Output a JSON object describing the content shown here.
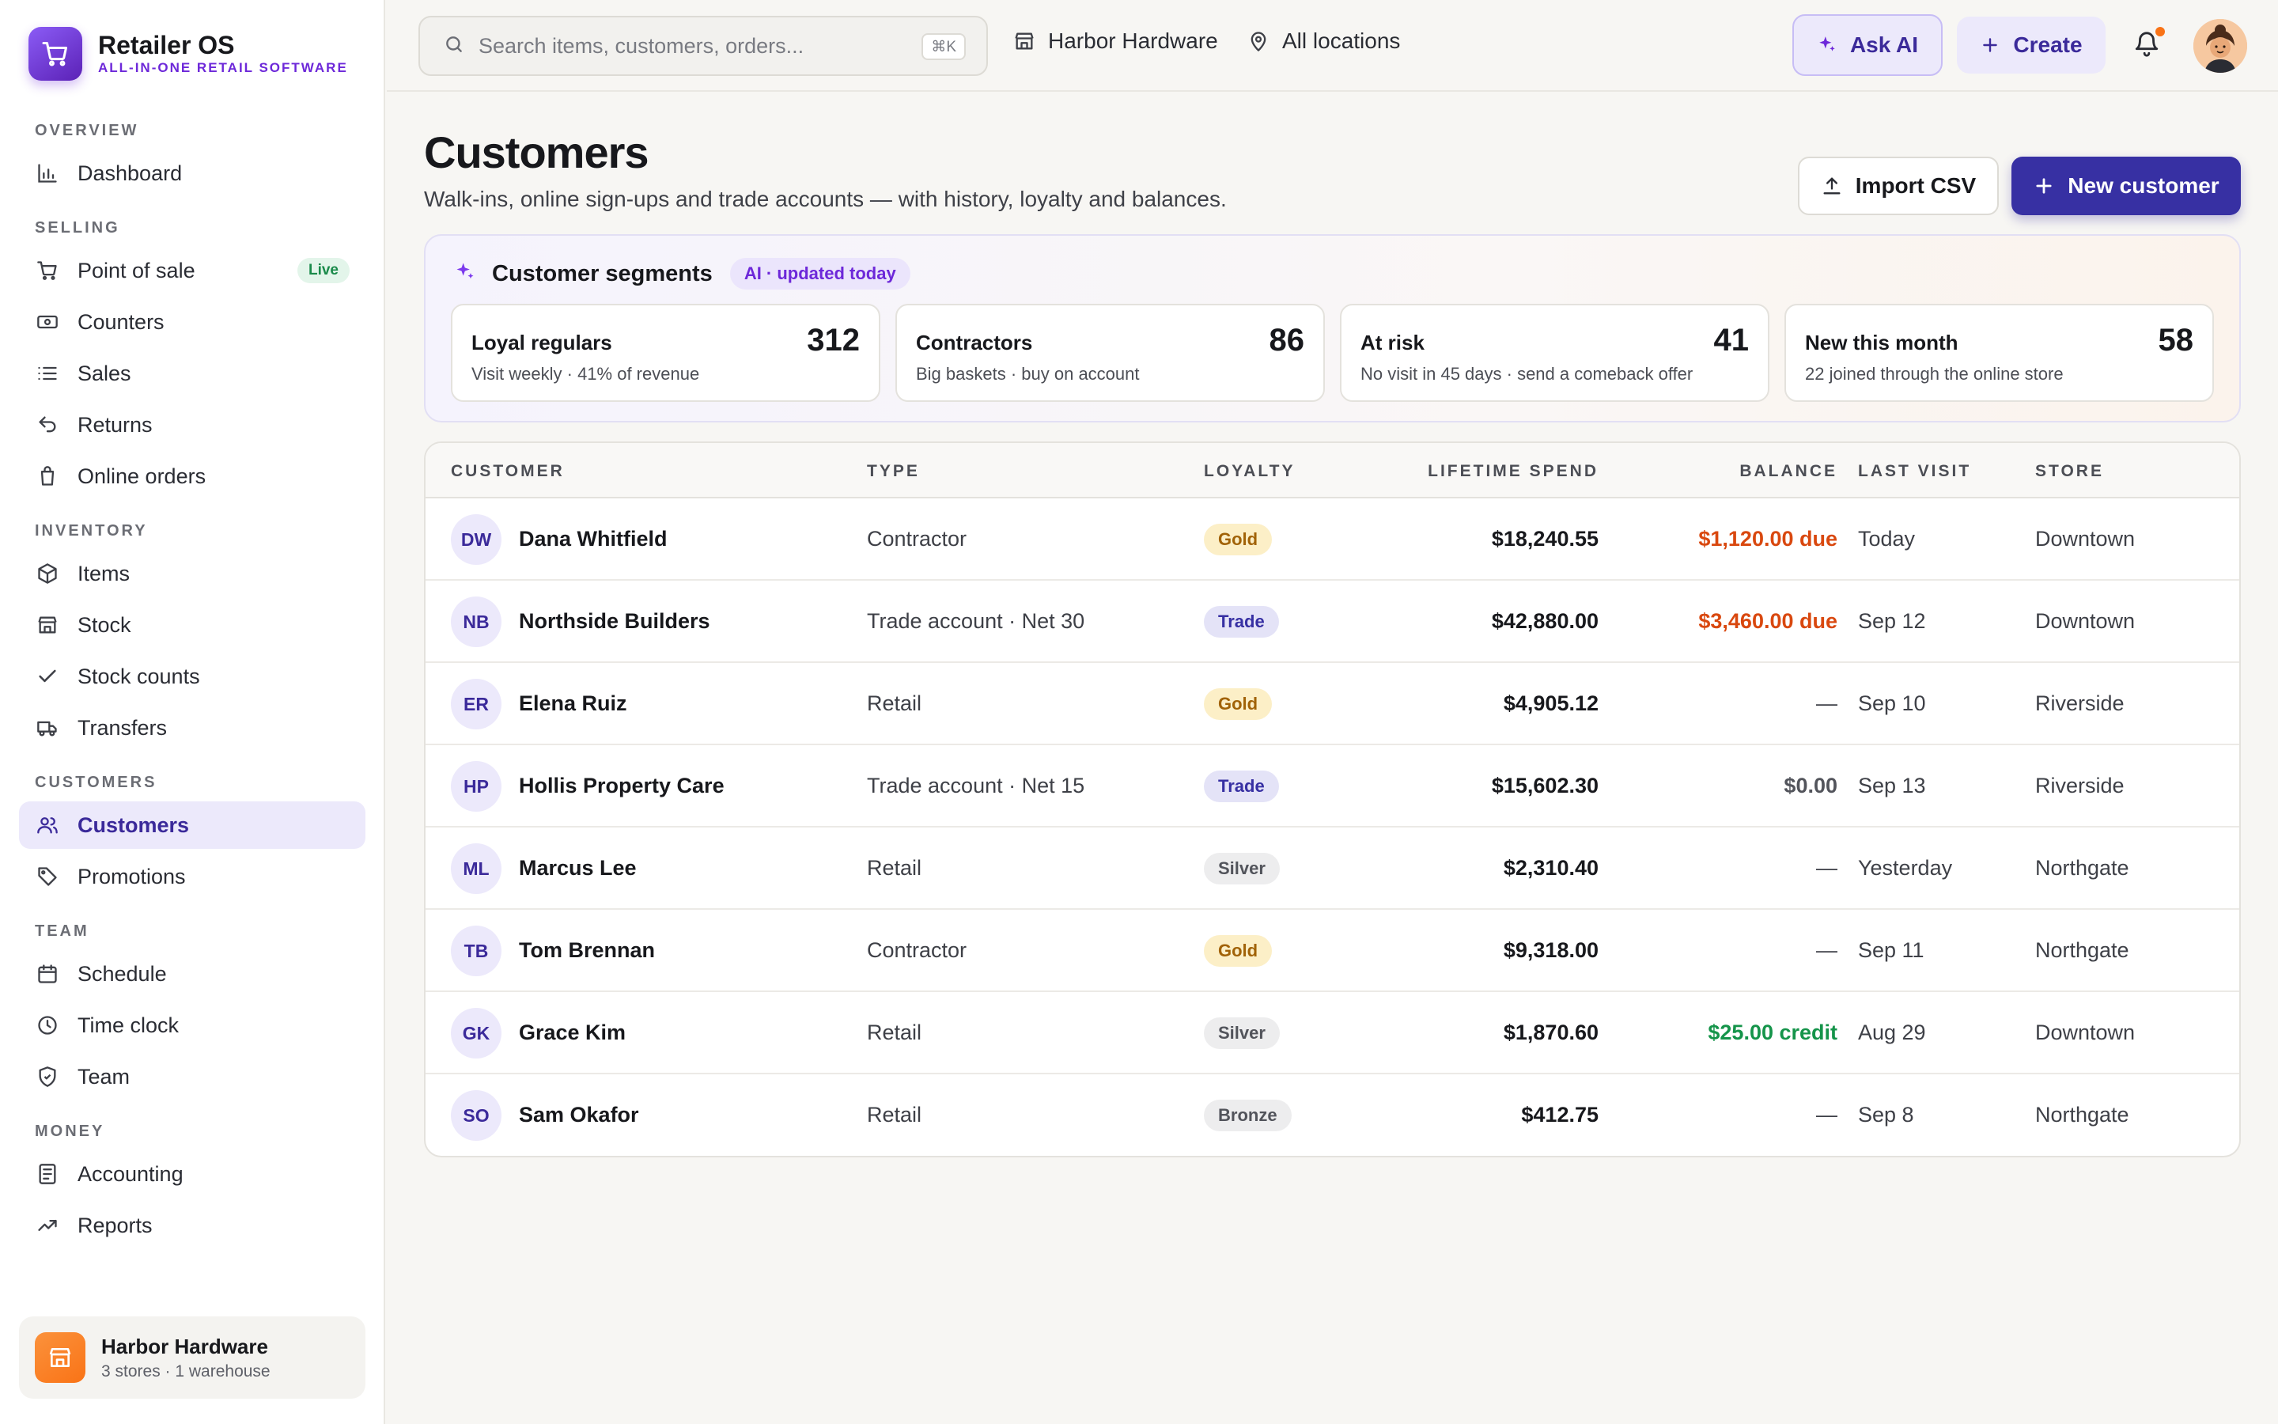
{
  "brand": {
    "name": "Retailer OS",
    "tagline": "ALL-IN-ONE RETAIL SOFTWARE"
  },
  "sidebar": {
    "sections": [
      {
        "label": "OVERVIEW",
        "items": [
          {
            "label": "Dashboard",
            "icon": "bar-chart-icon"
          }
        ]
      },
      {
        "label": "SELLING",
        "items": [
          {
            "label": "Point of sale",
            "icon": "cart-icon",
            "badge": "Live"
          },
          {
            "label": "Counters",
            "icon": "register-icon"
          },
          {
            "label": "Sales",
            "icon": "list-icon"
          },
          {
            "label": "Returns",
            "icon": "return-icon"
          },
          {
            "label": "Online orders",
            "icon": "bag-icon"
          }
        ]
      },
      {
        "label": "INVENTORY",
        "items": [
          {
            "label": "Items",
            "icon": "box-icon"
          },
          {
            "label": "Stock",
            "icon": "store-icon"
          },
          {
            "label": "Stock counts",
            "icon": "check-icon"
          },
          {
            "label": "Transfers",
            "icon": "truck-icon"
          }
        ]
      },
      {
        "label": "CUSTOMERS",
        "items": [
          {
            "label": "Customers",
            "icon": "users-icon",
            "active": true
          },
          {
            "label": "Promotions",
            "icon": "tag-icon"
          }
        ]
      },
      {
        "label": "TEAM",
        "items": [
          {
            "label": "Schedule",
            "icon": "calendar-icon"
          },
          {
            "label": "Time clock",
            "icon": "clock-icon"
          },
          {
            "label": "Team",
            "icon": "shield-icon"
          }
        ]
      },
      {
        "label": "MONEY",
        "items": [
          {
            "label": "Accounting",
            "icon": "ledger-icon"
          },
          {
            "label": "Reports",
            "icon": "trend-icon"
          }
        ]
      }
    ],
    "store": {
      "name": "Harbor Hardware",
      "sub": "3 stores · 1 warehouse"
    }
  },
  "topbar": {
    "search_placeholder": "Search items, customers, orders...",
    "shortcut": "⌘K",
    "business": "Harbor Hardware",
    "location": "All locations",
    "ask_ai": "Ask AI",
    "create": "Create"
  },
  "page": {
    "title": "Customers",
    "subtitle": "Walk-ins, online sign-ups and trade accounts — with history, loyalty and balances.",
    "import_label": "Import CSV",
    "new_label": "New customer"
  },
  "segments": {
    "title": "Customer segments",
    "ai_badge": "AI · updated today",
    "cards": [
      {
        "name": "Loyal regulars",
        "desc": "Visit weekly · 41% of revenue",
        "count": "312"
      },
      {
        "name": "Contractors",
        "desc": "Big baskets · buy on account",
        "count": "86"
      },
      {
        "name": "At risk",
        "desc": "No visit in 45 days · send a comeback offer",
        "count": "41"
      },
      {
        "name": "New this month",
        "desc": "22 joined through the online store",
        "count": "58"
      }
    ]
  },
  "table": {
    "headers": {
      "customer": "CUSTOMER",
      "type": "TYPE",
      "loyalty": "LOYALTY",
      "spend": "LIFETIME SPEND",
      "balance": "BALANCE",
      "last_visit": "LAST VISIT",
      "store": "STORE"
    },
    "rows": [
      {
        "initials": "DW",
        "name": "Dana Whitfield",
        "type": "Contractor",
        "loyalty": "Gold",
        "spend": "$18,240.55",
        "balance": "$1,120.00 due",
        "balance_kind": "due",
        "last_visit": "Today",
        "store": "Downtown"
      },
      {
        "initials": "NB",
        "name": "Northside Builders",
        "type": "Trade account · Net 30",
        "loyalty": "Trade",
        "spend": "$42,880.00",
        "balance": "$3,460.00 due",
        "balance_kind": "due",
        "last_visit": "Sep 12",
        "store": "Downtown"
      },
      {
        "initials": "ER",
        "name": "Elena Ruiz",
        "type": "Retail",
        "loyalty": "Gold",
        "spend": "$4,905.12",
        "balance": "—",
        "balance_kind": "none",
        "last_visit": "Sep 10",
        "store": "Riverside"
      },
      {
        "initials": "HP",
        "name": "Hollis Property Care",
        "type": "Trade account · Net 15",
        "loyalty": "Trade",
        "spend": "$15,602.30",
        "balance": "$0.00",
        "balance_kind": "zero",
        "last_visit": "Sep 13",
        "store": "Riverside"
      },
      {
        "initials": "ML",
        "name": "Marcus Lee",
        "type": "Retail",
        "loyalty": "Silver",
        "spend": "$2,310.40",
        "balance": "—",
        "balance_kind": "none",
        "last_visit": "Yesterday",
        "store": "Northgate"
      },
      {
        "initials": "TB",
        "name": "Tom Brennan",
        "type": "Contractor",
        "loyalty": "Gold",
        "spend": "$9,318.00",
        "balance": "—",
        "balance_kind": "none",
        "last_visit": "Sep 11",
        "store": "Northgate"
      },
      {
        "initials": "GK",
        "name": "Grace Kim",
        "type": "Retail",
        "loyalty": "Silver",
        "spend": "$1,870.60",
        "balance": "$25.00 credit",
        "balance_kind": "credit",
        "last_visit": "Aug 29",
        "store": "Downtown"
      },
      {
        "initials": "SO",
        "name": "Sam Okafor",
        "type": "Retail",
        "loyalty": "Bronze",
        "spend": "$412.75",
        "balance": "—",
        "balance_kind": "none",
        "last_visit": "Sep 8",
        "store": "Northgate"
      }
    ]
  },
  "colors": {
    "accent": "#3730a3",
    "brand": "#6d28d9",
    "due": "#d9480f",
    "credit": "#15944a"
  }
}
